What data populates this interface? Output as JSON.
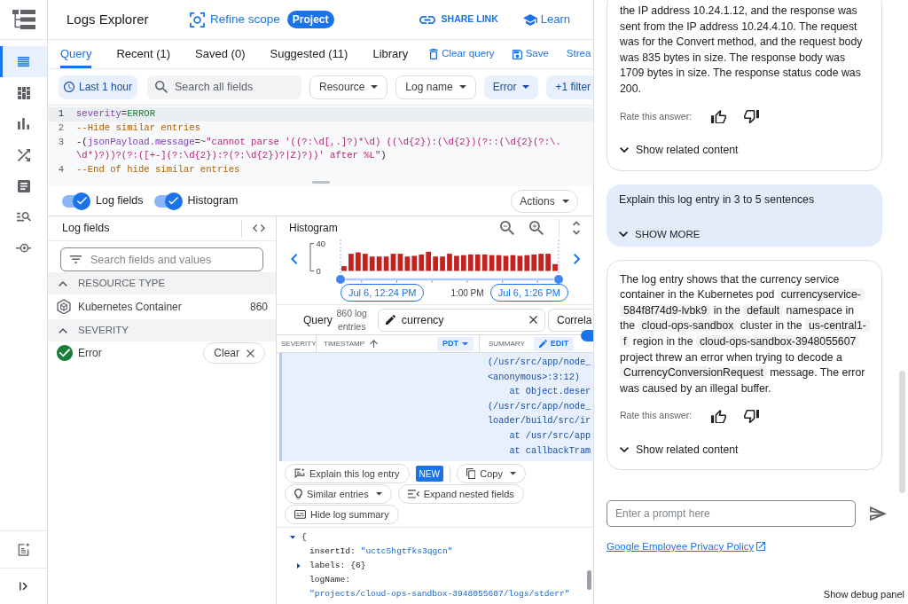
{
  "rail": {
    "items": [
      {
        "selected": true
      },
      {
        "selected": false
      },
      {
        "selected": false
      },
      {
        "selected": false
      },
      {
        "selected": false
      },
      {
        "selected": false
      },
      {
        "selected": false
      }
    ]
  },
  "header": {
    "title": "Logs Explorer",
    "scope_link": "Refine scope",
    "scope_badge": "Project",
    "share_link": "SHARE LINK",
    "learn_link": "Learn"
  },
  "tabs": [
    {
      "label": "Query",
      "selected": true
    },
    {
      "label": "Recent (1)",
      "selected": false
    },
    {
      "label": "Saved (0)",
      "selected": false
    },
    {
      "label": "Suggested (11)",
      "selected": false
    },
    {
      "label": "Library",
      "selected": false
    }
  ],
  "tab_actions": [
    {
      "label": "Clear query",
      "kind": "clear"
    },
    {
      "label": "Save",
      "kind": "save"
    },
    {
      "label": "Strea",
      "kind": "plain"
    }
  ],
  "filters": {
    "time_range": "Last 1 hour",
    "search": {
      "placeholder": "Search all fields"
    },
    "chips": [
      {
        "label": "Resource",
        "active": false,
        "dropdown": true
      },
      {
        "label": "Log name",
        "active": false,
        "dropdown": true
      },
      {
        "label": "Error",
        "active": true,
        "dropdown": true
      },
      {
        "label": "+1 filter",
        "active": true,
        "dropdown": false
      }
    ]
  },
  "query_editor": {
    "lines": [
      {
        "number": "1",
        "active": true,
        "tokens": [
          {
            "kind": "field",
            "text": "severity"
          },
          {
            "kind": "operator",
            "text": "="
          },
          {
            "kind": "value",
            "text": "ERROR"
          }
        ]
      },
      {
        "number": "2",
        "active": false,
        "tokens": [
          {
            "kind": "comment",
            "text": "--Hide similar entries"
          }
        ]
      },
      {
        "number": "3",
        "active": false,
        "tokens": [
          {
            "kind": "punct",
            "text": "-("
          },
          {
            "kind": "field",
            "text": "jsonPayload.message"
          },
          {
            "kind": "operator",
            "text": "=~"
          },
          {
            "kind": "string",
            "text": "\"cannot parse '((?:\\d[,.]?)*\\d) ((\\d{2}):(\\d{2})(?::(\\d{2}(?:\\.\\d*)?))?(?:([+-](?:\\d{2}):?(?:\\d{2})?|Z)?))' after %L\""
          },
          {
            "kind": "punct",
            "text": ")"
          }
        ]
      },
      {
        "number": "4",
        "active": false,
        "tokens": [
          {
            "kind": "comment",
            "text": "--End of hide similar entries"
          }
        ]
      }
    ]
  },
  "display_toggles": [
    {
      "label": "Log fields",
      "on": true
    },
    {
      "label": "Histogram",
      "on": true
    }
  ],
  "actions_button": "Actions",
  "log_fields": {
    "title": "Log fields",
    "search": {
      "placeholder": "Search fields and values"
    },
    "sections": [
      {
        "title": "RESOURCE TYPE",
        "expanded": true,
        "items": [
          {
            "kind": "resource",
            "label": "Kubernetes Container",
            "count": "860"
          }
        ]
      },
      {
        "title": "SEVERITY",
        "expanded": true,
        "items": [
          {
            "kind": "severity",
            "label": "Error",
            "clear_label": "Clear"
          }
        ]
      }
    ]
  },
  "histogram": {
    "title": "Histogram",
    "y_axis_labels": [
      "40",
      "0"
    ],
    "range_start": "Jul 6, 12:24 PM",
    "time_label": "1:00 PM",
    "range_end": "Jul 6, 1:26 PM"
  },
  "results": {
    "query_label": "Query",
    "count": "860 log entries",
    "search": {
      "value": "currency"
    },
    "cut_button": "Correla",
    "columns": [
      {
        "label": "SEVERITY",
        "kind": "plain"
      },
      {
        "label": "TIMESTAMP",
        "kind": "timestamp",
        "sorted": true,
        "timezone": "PDT"
      },
      {
        "label": "SUMMARY",
        "kind": "summary",
        "edit_label": "EDIT"
      }
    ],
    "summary_toggle": {
      "on": true
    }
  },
  "entry": {
    "stack_lines": [
      "(/usr/src/app/node_",
      "<anonymous>:3:12)",
      "    at Object.deser",
      "(/usr/src/app/node_",
      "loader/build/src/ir",
      "    at /usr/src/app",
      "    at callbackTram"
    ],
    "buttons": [
      {
        "label": "Explain this log entry",
        "kind": "explain",
        "badge": "NEW",
        "dropdown": false
      },
      {
        "label": "Copy",
        "kind": "copy",
        "dropdown": true
      },
      {
        "label": "Similar entries",
        "kind": "similar",
        "dropdown": true
      },
      {
        "label": "Expand nested fields",
        "kind": "expand",
        "dropdown": false
      },
      {
        "label": "Hide log summary",
        "kind": "hide",
        "dropdown": false
      }
    ],
    "json": {
      "open": "{",
      "expanded": true,
      "fields": [
        {
          "kind": "string",
          "key": "insertId:",
          "value": "\"uctc5hgtfks3qgcn\""
        },
        {
          "kind": "object",
          "key": "labels:",
          "value": "{6}",
          "expanded": false
        },
        {
          "kind": "string",
          "key": "logName:",
          "value": "\"projects/cloud-ops-sandbox-3948055607/logs/stderr\""
        }
      ]
    }
  },
  "assistant": {
    "messages": [
      {
        "kind": "answer",
        "segments": [
          {
            "kind": "text",
            "text": "the IP address 10.24.1.12, and the response was sent from the IP address 10.24.4.10. The request was for the Convert method, and the request body was 835 bytes in size. The response body was 1709 bytes in size. The response status code was 200."
          }
        ],
        "rate_label": "Rate this answer:",
        "related_label": "Show related content"
      },
      {
        "kind": "prompt",
        "text": "Explain this log entry in 3 to 5 sentences",
        "more_label": "SHOW MORE"
      },
      {
        "kind": "answer",
        "segments": [
          {
            "kind": "text",
            "text": "The log entry shows that the currency service container in the Kubernetes pod "
          },
          {
            "kind": "code",
            "text": "currencyservice-584f8f74d9-lvbk9"
          },
          {
            "kind": "text",
            "text": " in the "
          },
          {
            "kind": "code",
            "text": "default"
          },
          {
            "kind": "text",
            "text": " namespace in the "
          },
          {
            "kind": "code",
            "text": "cloud-ops-sandbox"
          },
          {
            "kind": "text",
            "text": " cluster in the "
          },
          {
            "kind": "code",
            "text": "us-central1-f"
          },
          {
            "kind": "text",
            "text": " region in the "
          },
          {
            "kind": "code",
            "text": "cloud-ops-sandbox-3948055607"
          },
          {
            "kind": "text",
            "text": " project threw an error when trying to decode a "
          },
          {
            "kind": "code",
            "text": "CurrencyConversionRequest"
          },
          {
            "kind": "text",
            "text": " message. The error was caused by an illegal buffer."
          }
        ],
        "rate_label": "Rate this answer:",
        "related_label": "Show related content"
      }
    ],
    "input": {
      "placeholder": "Enter a prompt here"
    },
    "privacy_link": "Google Employee Privacy Policy",
    "debug_link": "Show debug panel"
  }
}
